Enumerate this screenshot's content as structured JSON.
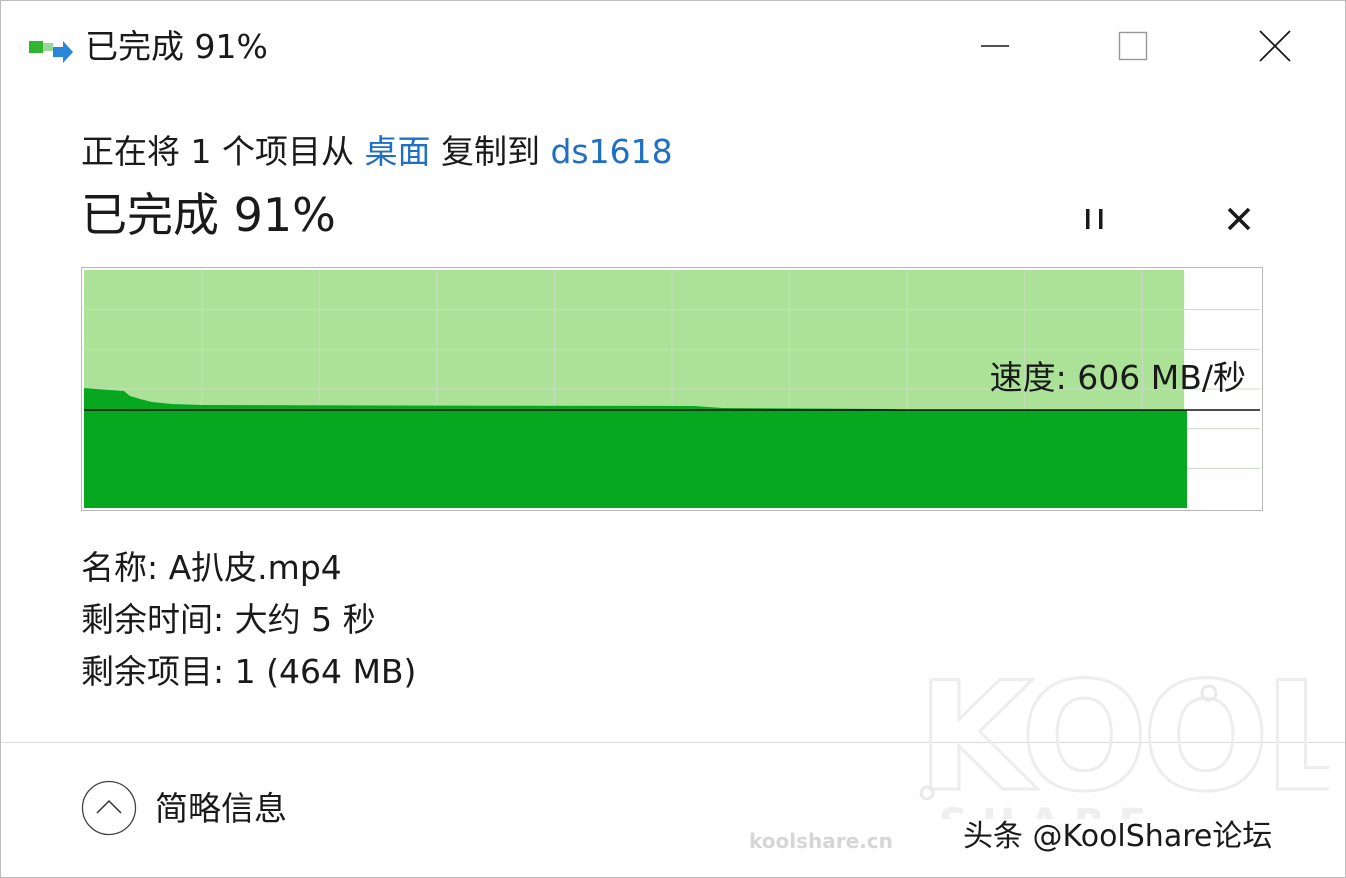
{
  "window": {
    "title": "已完成 91%",
    "controls": {
      "minimize": "minimize-icon",
      "maximize": "maximize-icon",
      "close": "close-icon"
    }
  },
  "copy_line": {
    "prefix": "正在将 1 个项目从 ",
    "source": "桌面",
    "middle": " 复制到 ",
    "destination": "ds1618"
  },
  "status": {
    "text": "已完成 91%",
    "percent": 91,
    "pause_icon": "pause-icon",
    "cancel_icon": "cancel-icon"
  },
  "speed_graph": {
    "speed_label": "速度: 606 MB/秒",
    "progress_fraction": 0.91,
    "colors": {
      "progress_area": "#abe298",
      "speed_fill": "#06a820",
      "speed_line": "#111111",
      "grid": "#c8dcc4"
    }
  },
  "details": {
    "name": "名称:  A扒皮.mp4",
    "time_remaining": "剩余时间:  大约 5 秒",
    "items_remaining": "剩余项目:  1 (464 MB)"
  },
  "footer": {
    "collapse_label": "简略信息",
    "collapse_icon": "chevron-up-icon"
  },
  "watermark": {
    "logo_text": "KOOL",
    "sub_text": "S  H  A  R  E",
    "site": "koolshare.cn",
    "credit": "头条 @KoolShare论坛"
  }
}
